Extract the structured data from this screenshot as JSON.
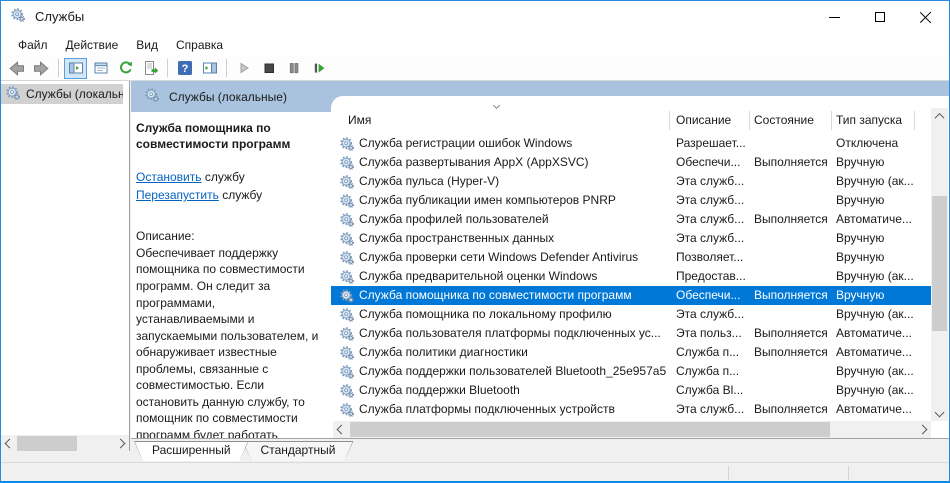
{
  "window": {
    "title": "Службы"
  },
  "titlebar": {
    "controls": [
      "minimize",
      "maximize",
      "close"
    ]
  },
  "menu": {
    "items": [
      "Файл",
      "Действие",
      "Вид",
      "Справка"
    ]
  },
  "toolbar": {
    "icons": [
      "back-icon",
      "forward-icon",
      "show-console-tree-icon",
      "properties-icon",
      "refresh-icon",
      "export-list-icon",
      "help-icon",
      "show-action-pane-icon",
      "start-service-icon",
      "stop-service-icon",
      "pause-service-icon",
      "restart-service-icon"
    ],
    "pressed": "show-console-tree-icon"
  },
  "tree": {
    "root_label": "Службы (локальные)"
  },
  "main": {
    "header": "Службы (локальные)",
    "panel": {
      "service_title": "Служба помощника по совместимости программ",
      "stop_link": "Остановить",
      "stop_suffix": " службу",
      "restart_link": "Перезапустить",
      "restart_suffix": " службу",
      "description_label": "Описание:",
      "description_text": "Обеспечивает поддержку помощника по совместимости программ. Он следит за программами, устанавливаемыми и запускаемыми пользователем, и обнаруживает известные проблемы, связанные с совместимостью. Если остановить данную службу, то помощник по совместимости программ будет работать неправильно."
    },
    "table": {
      "columns": [
        "Имя",
        "Описание",
        "Состояние",
        "Тип запуска"
      ],
      "sorted_column": "Имя",
      "rows": [
        {
          "name": "Служба регистрации ошибок Windows",
          "description": "Разрешает...",
          "status": "",
          "startup": "Отключена",
          "selected": false
        },
        {
          "name": "Служба развертывания AppX (AppXSVC)",
          "description": "Обеспечи...",
          "status": "Выполняется",
          "startup": "Вручную",
          "selected": false
        },
        {
          "name": "Служба пульса (Hyper-V)",
          "description": "Эта служб...",
          "status": "",
          "startup": "Вручную (ак...",
          "selected": false
        },
        {
          "name": "Служба публикации имен компьютеров PNRP",
          "description": "Эта служб...",
          "status": "",
          "startup": "Вручную",
          "selected": false
        },
        {
          "name": "Служба профилей пользователей",
          "description": "Эта служб...",
          "status": "Выполняется",
          "startup": "Автоматиче...",
          "selected": false
        },
        {
          "name": "Служба пространственных данных",
          "description": "Эта служб...",
          "status": "",
          "startup": "Вручную",
          "selected": false
        },
        {
          "name": "Служба проверки сети Windows Defender Antivirus",
          "description": "Позволяет...",
          "status": "",
          "startup": "Вручную",
          "selected": false
        },
        {
          "name": "Служба предварительной оценки Windows",
          "description": "Предостав...",
          "status": "",
          "startup": "Вручную (ак...",
          "selected": false
        },
        {
          "name": "Служба помощника по совместимости программ",
          "description": "Обеспечи...",
          "status": "Выполняется",
          "startup": "Вручную",
          "selected": true
        },
        {
          "name": "Служба помощника по локальному профилю",
          "description": "Эта служб...",
          "status": "",
          "startup": "Вручную (ак...",
          "selected": false
        },
        {
          "name": "Служба пользователя платформы подключенных ус...",
          "description": "Эта польз...",
          "status": "Выполняется",
          "startup": "Автоматиче...",
          "selected": false
        },
        {
          "name": "Служба политики диагностики",
          "description": "Служба п...",
          "status": "Выполняется",
          "startup": "Автоматиче...",
          "selected": false
        },
        {
          "name": "Служба поддержки пользователей Bluetooth_25e957a5",
          "description": "Служба п...",
          "status": "",
          "startup": "Вручную (ак...",
          "selected": false
        },
        {
          "name": "Служба поддержки Bluetooth",
          "description": "Служба Bl...",
          "status": "",
          "startup": "Вручную (ак...",
          "selected": false
        },
        {
          "name": "Служба платформы подключенных устройств",
          "description": "Эта служб...",
          "status": "Выполняется",
          "startup": "Автоматиче...",
          "selected": false
        }
      ]
    },
    "tabs": [
      "Расширенный",
      "Стандартный"
    ],
    "active_tab": "Расширенный"
  },
  "colors": {
    "accent_border": "#0c8be4",
    "header_band": "#a9c3de",
    "selection": "#0078d7",
    "link": "#0563c1",
    "inactive_selection": "#d1d1d1"
  }
}
